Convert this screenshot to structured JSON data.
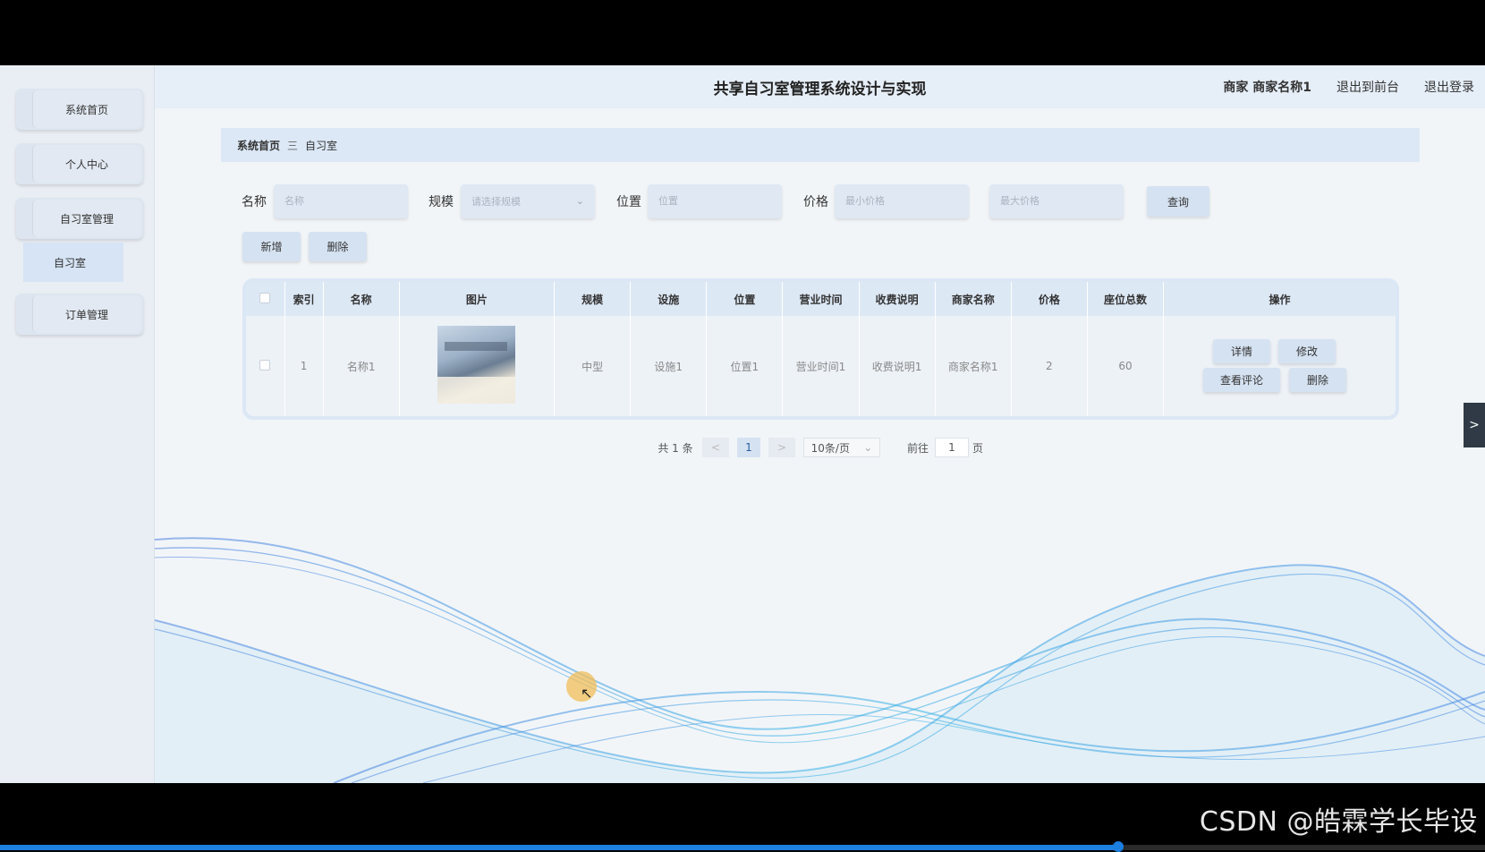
{
  "app": {
    "title": "共享自习室管理系统设计与实现"
  },
  "header": {
    "user_label": "商家 商家名称1",
    "back_to_front": "退出到前台",
    "logout": "退出登录"
  },
  "sidebar": {
    "items": [
      {
        "label": "系统首页"
      },
      {
        "label": "个人中心"
      },
      {
        "label": "自习室管理"
      },
      {
        "label": "订单管理"
      }
    ],
    "submenu": {
      "label": "自习室"
    }
  },
  "breadcrumb": {
    "home": "系统首页",
    "separator": "三",
    "current": "自习室"
  },
  "search": {
    "name_label": "名称",
    "name_placeholder": "名称",
    "scale_label": "规模",
    "scale_placeholder": "请选择规模",
    "location_label": "位置",
    "location_placeholder": "位置",
    "price_label": "价格",
    "min_price_placeholder": "最小价格",
    "max_price_placeholder": "最大价格",
    "query_button": "查询"
  },
  "actions": {
    "add": "新增",
    "delete": "删除"
  },
  "table": {
    "columns": [
      "索引",
      "名称",
      "图片",
      "规模",
      "设施",
      "位置",
      "营业时间",
      "收费说明",
      "商家名称",
      "价格",
      "座位总数",
      "操作"
    ],
    "rows": [
      {
        "index": "1",
        "name": "名称1",
        "scale": "中型",
        "facility": "设施1",
        "location": "位置1",
        "hours": "营业时间1",
        "fee_note": "收费说明1",
        "merchant": "商家名称1",
        "price": "2",
        "seats": "60",
        "ops": {
          "detail": "详情",
          "edit": "修改",
          "reviews": "查看评论",
          "delete": "删除"
        }
      }
    ]
  },
  "pagination": {
    "total": "共 1 条",
    "prev": "<",
    "current": "1",
    "next": ">",
    "page_size": "10条/页",
    "goto_label": "前往",
    "goto_value": "1",
    "page_unit": "页"
  },
  "overlay": {
    "watermark": "CSDN @皓霖学长毕设",
    "side_tab": ">",
    "video_progress": 0.753
  },
  "colors": {
    "accent": "#d5e2f1",
    "wave": "#4aa8e0"
  }
}
